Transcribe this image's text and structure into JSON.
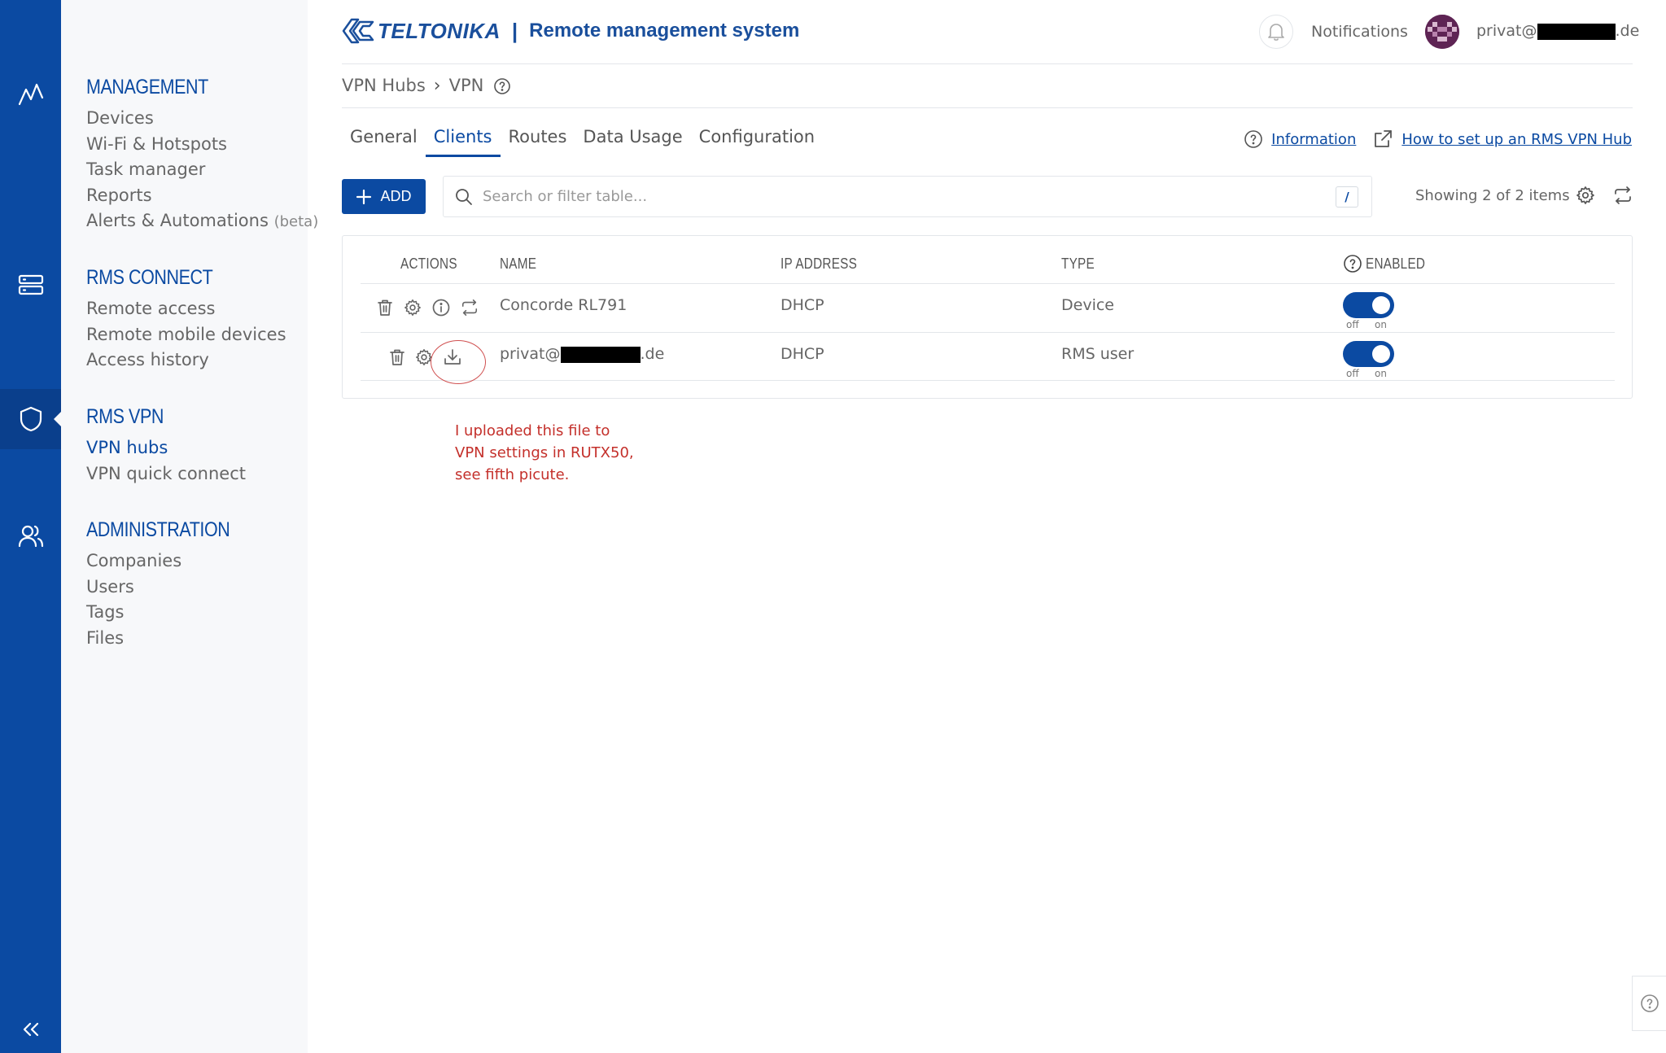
{
  "app": {
    "logo_text": "TELTONIKA",
    "separator": "|",
    "title": "Remote management system",
    "notifications_label": "Notifications",
    "user_email_prefix": "privat@",
    "user_email_suffix": ".de"
  },
  "rail": {
    "icons": [
      "monitoring-icon",
      "devices-icon",
      "shield-icon",
      "users-icon",
      "collapse-icon"
    ]
  },
  "menu": {
    "management": {
      "title": "MANAGEMENT",
      "items": [
        "Devices",
        "Wi-Fi & Hotspots",
        "Task manager",
        "Reports",
        "Alerts & Automations"
      ],
      "beta_tag": "(beta)"
    },
    "rms_connect": {
      "title": "RMS CONNECT",
      "items": [
        "Remote access",
        "Remote mobile devices",
        "Access history"
      ]
    },
    "rms_vpn": {
      "title": "RMS VPN",
      "items": [
        "VPN hubs",
        "VPN quick connect"
      ]
    },
    "administration": {
      "title": "ADMINISTRATION",
      "items": [
        "Companies",
        "Users",
        "Tags",
        "Files"
      ]
    }
  },
  "breadcrumb": {
    "parent": "VPN Hubs",
    "separator": "›",
    "current": "VPN"
  },
  "tabs": [
    "General",
    "Clients",
    "Routes",
    "Data Usage",
    "Configuration"
  ],
  "active_tab": "Clients",
  "links": {
    "information": "Information",
    "setup": "How to set up an RMS VPN Hub"
  },
  "toolbar": {
    "add_label": "ADD",
    "search_placeholder": "Search or filter table...",
    "shortcut_key": "/",
    "showing_text": "Showing 2 of 2 items"
  },
  "table": {
    "headers": {
      "actions": "ACTIONS",
      "name": "NAME",
      "ip": "IP ADDRESS",
      "type": "TYPE",
      "enabled": "ENABLED"
    },
    "rows": [
      {
        "name": "Concorde RL791",
        "ip": "DHCP",
        "type": "Device",
        "enabled": true,
        "off_label": "off",
        "on_label": "on"
      },
      {
        "name_prefix": "privat@",
        "name_suffix": ".de",
        "ip": "DHCP",
        "type": "RMS user",
        "enabled": true,
        "off_label": "off",
        "on_label": "on"
      }
    ]
  },
  "annotation": {
    "line1": "I uploaded this file to",
    "line2": "VPN settings in RUTX50,",
    "line3": "see fifth picute."
  },
  "colors": {
    "brand_blue": "#0b4aa2",
    "annotation_red": "#c4302b"
  }
}
